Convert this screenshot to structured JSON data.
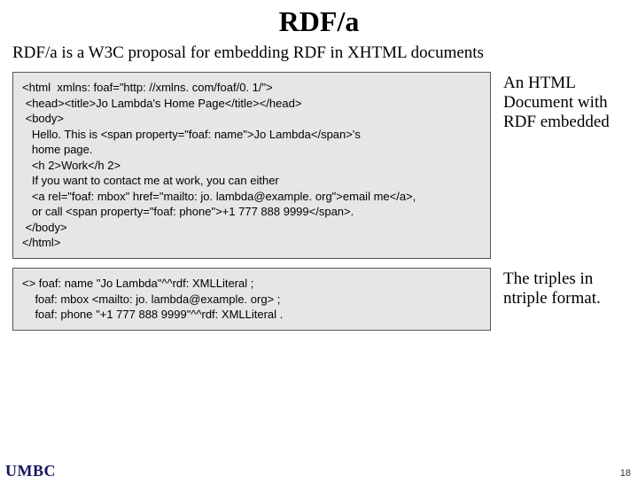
{
  "title": "RDF/a",
  "intro": "RDF/a is a W3C proposal for embedding RDF in XHTML documents",
  "code1": "<html  xmlns: foaf=\"http: //xmlns. com/foaf/0. 1/\">\n <head><title>Jo Lambda's Home Page</title></head>\n <body>\n   Hello. This is <span property=\"foaf: name\">Jo Lambda</span>'s\n   home page.\n   <h 2>Work</h 2>\n   If you want to contact me at work, you can either\n   <a rel=\"foaf: mbox\" href=\"mailto: jo. lambda@example. org\">email me</a>,\n   or call <span property=\"foaf: phone\">+1 777 888 9999</span>.\n </body>\n</html>",
  "caption1": "An HTML Document with RDF embedded",
  "code2": "<> foaf: name \"Jo Lambda\"^^rdf: XMLLiteral ;\n    foaf: mbox <mailto: jo. lambda@example. org> ;\n    foaf: phone \"+1 777 888 9999\"^^rdf: XMLLiteral .",
  "caption2": "The triples in ntriple format.",
  "footer_left": "UMBC",
  "footer_right": "18"
}
